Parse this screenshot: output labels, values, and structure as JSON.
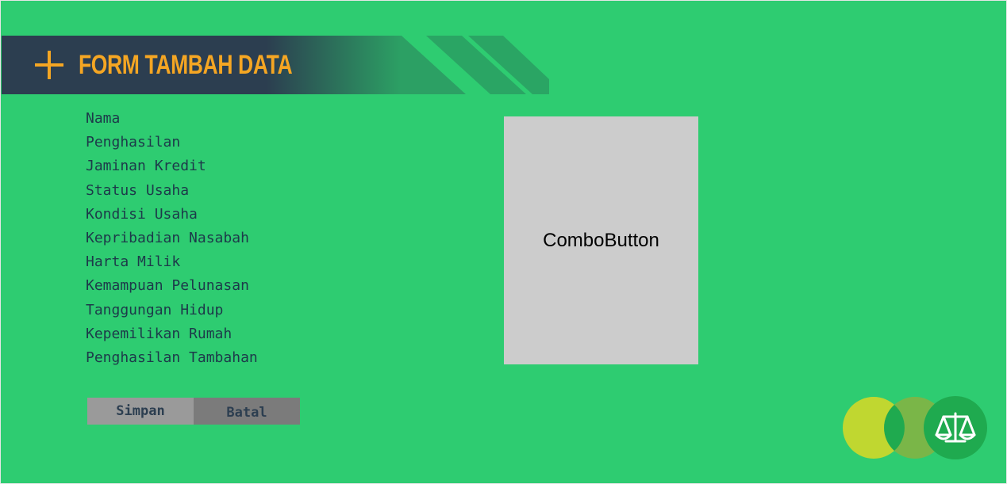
{
  "header": {
    "icon": "plus-icon",
    "title": "FORM TAMBAH DATA"
  },
  "form": {
    "labels": [
      "Nama",
      "Penghasilan",
      "Jaminan Kredit",
      "Status Usaha",
      "Kondisi Usaha",
      "Kepribadian Nasabah",
      "Harta Milik",
      "Kemampuan Pelunasan",
      "Tanggungan Hidup",
      "Kepemilikan Rumah",
      "Penghasilan Tambahan"
    ]
  },
  "combo": {
    "label": "ComboButton"
  },
  "actions": {
    "save_label": "Simpan",
    "cancel_label": "Batal"
  },
  "logo": {
    "icon": "balance-scale-icon"
  },
  "colors": {
    "background": "#2ecc71",
    "header_dark": "#2c3e50",
    "accent": "#f5a623",
    "label_text": "#1d3a4a",
    "combo_bg": "#cccccc",
    "save_bg": "#9a9a9a",
    "cancel_bg": "#7b7b7b",
    "logo_lime": "#c0d730",
    "logo_olive": "#7ab648",
    "logo_green": "#1faa4f"
  }
}
